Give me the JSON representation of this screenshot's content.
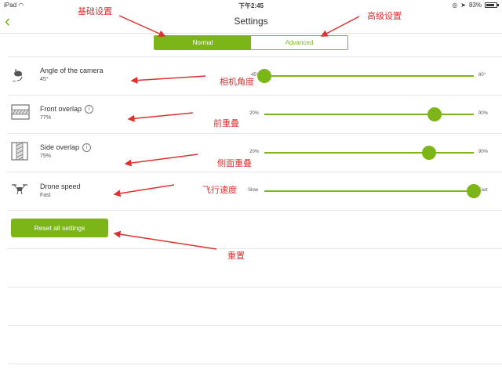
{
  "status_bar": {
    "device": "iPad",
    "time": "下午2:45",
    "battery": "83%",
    "battery_level": 0.83
  },
  "nav": {
    "title": "Settings"
  },
  "segments": {
    "normal": "Normal",
    "advanced": "Advanced"
  },
  "rows": [
    {
      "label": "Angle of the camera",
      "value": "45°",
      "min_label": "45°",
      "max_label": "80°",
      "slider_value": 0.0,
      "icon": "camera-angle-icon"
    },
    {
      "label": "Front overlap",
      "value": "77%",
      "min_label": "20%",
      "max_label": "90%",
      "slider_value": 0.814,
      "icon": "front-overlap-icon"
    },
    {
      "label": "Side overlap",
      "value": "75%",
      "min_label": "20%",
      "max_label": "90%",
      "slider_value": 0.786,
      "icon": "side-overlap-icon"
    },
    {
      "label": "Drone speed",
      "value": "Fast",
      "min_label": "Slow",
      "max_label": "Fast",
      "slider_value": 1.0,
      "icon": "drone-icon"
    }
  ],
  "reset": {
    "label": "Reset all settings"
  },
  "annotations": {
    "basic": "基础设置",
    "advanced": "高级设置",
    "camera_angle": "相机角度",
    "front_overlap": "前重叠",
    "side_overlap": "侧面重叠",
    "speed": "飞行速度",
    "reset": "重置"
  },
  "colors": {
    "accent": "#7cb518",
    "annotation": "#e03030"
  }
}
